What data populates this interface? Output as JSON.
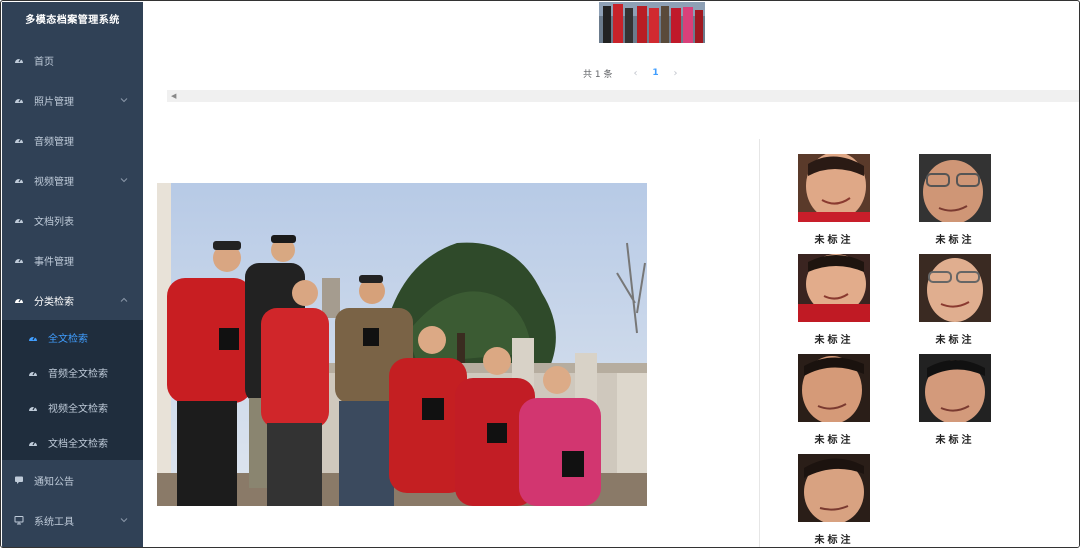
{
  "app": {
    "title": "多模态档案管理系统"
  },
  "sidebar": {
    "items": [
      {
        "label": "首页",
        "icon": "dashboard-icon",
        "expandable": false
      },
      {
        "label": "照片管理",
        "icon": "dashboard-icon",
        "expandable": true
      },
      {
        "label": "音频管理",
        "icon": "dashboard-icon",
        "expandable": false
      },
      {
        "label": "视频管理",
        "icon": "dashboard-icon",
        "expandable": true
      },
      {
        "label": "文档列表",
        "icon": "dashboard-icon",
        "expandable": false
      },
      {
        "label": "事件管理",
        "icon": "dashboard-icon",
        "expandable": false
      },
      {
        "label": "分类检索",
        "icon": "dashboard-icon",
        "expandable": true,
        "expanded": true
      }
    ],
    "subitems": [
      {
        "label": "全文检索",
        "active": true
      },
      {
        "label": "音频全文检索"
      },
      {
        "label": "视频全文检索"
      },
      {
        "label": "文档全文检索"
      }
    ],
    "bottom_items": [
      {
        "label": "通知公告",
        "icon": "message-icon"
      },
      {
        "label": "系统工具",
        "icon": "monitor-icon",
        "expandable": true
      }
    ]
  },
  "pagination": {
    "total": "共 1 条",
    "current": "1"
  },
  "faces": [
    {
      "label": "未标注"
    },
    {
      "label": "未标注"
    },
    {
      "label": "未标注"
    },
    {
      "label": "未标注"
    },
    {
      "label": "未标注"
    },
    {
      "label": "未标注"
    },
    {
      "label": "未标注"
    }
  ],
  "colors": {
    "sidebar_bg": "#304156",
    "submenu_bg": "#1f2d3d",
    "active": "#409eff"
  }
}
